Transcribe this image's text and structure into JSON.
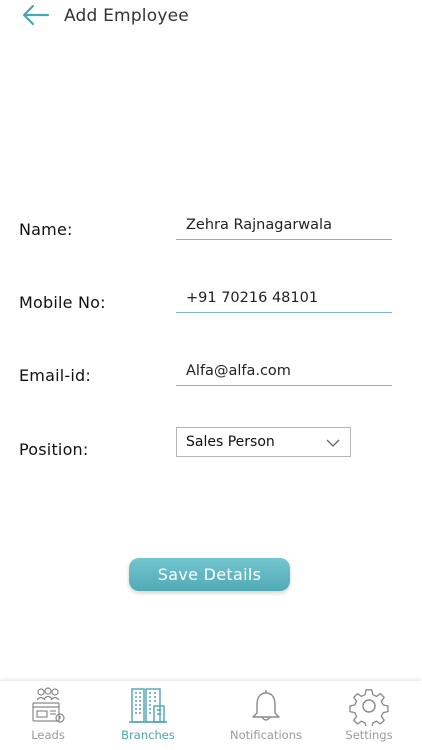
{
  "header": {
    "title": "Add Employee",
    "back_icon": "arrow-left-icon",
    "accent_color": "#4aa6b3"
  },
  "form": {
    "name_label": "Name:",
    "name_value": "Zehra Rajnagarwala",
    "mobile_label": "Mobile No:",
    "mobile_value": "+91 70216 48101",
    "email_label": "Email-id:",
    "email_value": "Alfa@alfa.com",
    "position_label": "Position:",
    "position_value": "Sales Person",
    "position_icon": "chevron-down-icon"
  },
  "actions": {
    "save_label": "Save Details",
    "save_color": "#5fb6c0"
  },
  "bottom_nav": {
    "items": [
      {
        "label": "Leads",
        "icon": "leads-icon",
        "active": false
      },
      {
        "label": "Branches",
        "icon": "buildings-icon",
        "active": true
      },
      {
        "label": "Notifications",
        "icon": "bell-icon",
        "active": false
      },
      {
        "label": "Settings",
        "icon": "gear-icon",
        "active": false
      }
    ],
    "active_color": "#4aa6b3",
    "inactive_color": "#9a9a9a"
  }
}
